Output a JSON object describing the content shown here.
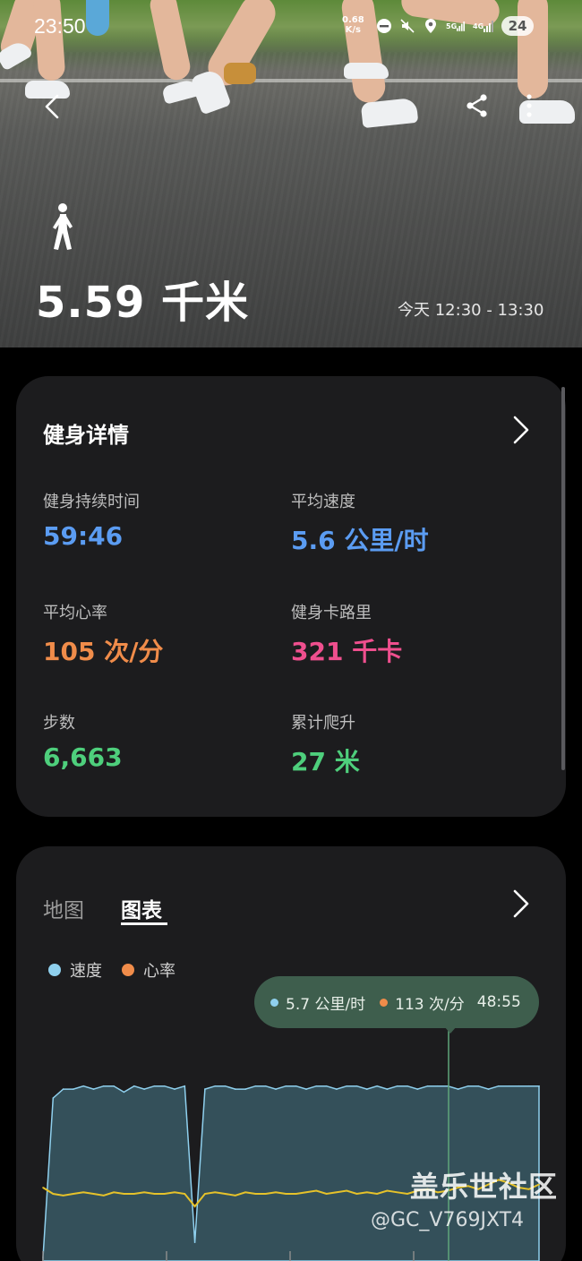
{
  "status_bar": {
    "time": "23:50",
    "net_speed_value": "0.68",
    "net_speed_unit": "K/s",
    "signal1": "5G",
    "signal2": "4G",
    "battery": "24"
  },
  "hero": {
    "distance": "5.59 千米",
    "time_range": "今天 12:30 - 13:30",
    "activity_icon": "walking-person-icon"
  },
  "details": {
    "title": "健身详情",
    "stats": [
      {
        "label": "健身持续时间",
        "value": "59:46",
        "color": "#5b9cf2"
      },
      {
        "label": "平均速度",
        "value": "5.6 公里/时",
        "color": "#5b9cf2"
      },
      {
        "label": "平均心率",
        "value": "105 次/分",
        "color": "#f08c4a"
      },
      {
        "label": "健身卡路里",
        "value": "321 千卡",
        "color": "#ef4f8e"
      },
      {
        "label": "步数",
        "value": "6,663",
        "color": "#4ecf7c"
      },
      {
        "label": "累计爬升",
        "value": "27 米",
        "color": "#4ecf7c"
      }
    ]
  },
  "charts_card": {
    "tab_map": "地图",
    "tab_chart": "图表",
    "legend_speed": "速度",
    "legend_hr": "心率",
    "tooltip_speed": "5.7 公里/时",
    "tooltip_hr": "113 次/分",
    "tooltip_time": "48:55"
  },
  "colors": {
    "speed": "#8fd0ee",
    "heart_rate": "#f08c4a",
    "hr_line": "#e6c22a",
    "tooltip_bg": "#3e5e4d"
  },
  "watermark": {
    "site": "盖乐世社区",
    "user": "@GC_V769JXT4"
  },
  "chart_data": {
    "type": "area",
    "series": [
      {
        "name": "速度",
        "values": [
          0.0,
          5.3,
          5.6,
          5.6,
          5.7,
          5.6,
          5.7,
          5.7,
          5.5,
          5.7,
          5.6,
          5.7,
          5.7,
          5.6,
          5.7,
          0.5,
          5.6,
          5.7,
          5.7,
          5.6,
          5.6,
          5.7,
          5.7,
          5.6,
          5.7,
          5.7,
          5.6,
          5.7,
          5.7,
          5.6,
          5.7,
          5.7,
          5.6,
          5.7,
          5.6,
          5.7,
          5.7,
          5.6,
          5.7,
          5.7,
          5.7,
          5.6,
          5.7,
          5.7,
          5.6,
          5.7,
          5.7,
          5.7,
          5.7,
          5.7
        ]
      },
      {
        "name": "心率",
        "values": [
          108,
          104,
          103,
          104,
          105,
          104,
          103,
          105,
          104,
          104,
          105,
          104,
          104,
          105,
          104,
          96,
          104,
          105,
          104,
          103,
          105,
          104,
          104,
          105,
          104,
          104,
          105,
          106,
          104,
          105,
          106,
          104,
          105,
          104,
          106,
          105,
          104,
          106,
          107,
          105,
          106,
          108,
          109,
          107,
          110,
          113,
          111,
          108,
          107,
          110
        ]
      }
    ],
    "x_range": [
      "0:00",
      "59:46"
    ],
    "highlight": {
      "time": "48:55",
      "speed": 5.7,
      "heart_rate": 113
    }
  }
}
